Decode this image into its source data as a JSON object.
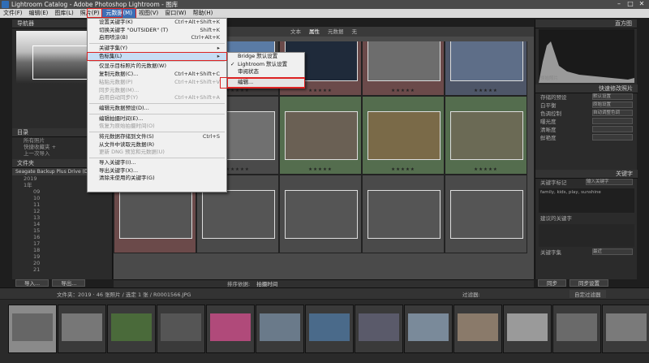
{
  "window": {
    "title": "Lightroom Catalog - Adobe Photoshop Lightroom - 图库",
    "controls": [
      "–",
      "□",
      "✕"
    ]
  },
  "menubar": {
    "items": [
      {
        "label": "文件(F)",
        "active": false
      },
      {
        "label": "编辑(E)",
        "active": false
      },
      {
        "label": "图库(L)",
        "active": false
      },
      {
        "label": "照片(P)",
        "active": false
      },
      {
        "label": "元数据(M)",
        "active": true
      },
      {
        "label": "视图(V)",
        "active": false
      },
      {
        "label": "窗口(W)",
        "active": false
      },
      {
        "label": "帮助(H)",
        "active": false
      }
    ]
  },
  "dropdown": {
    "items": [
      {
        "label": "设置关键字(K)",
        "shortcut": "Ctrl+Alt+Shift+K",
        "type": "item"
      },
      {
        "label": "切换关键字 \"OUTSIDER\" (T)",
        "shortcut": "Shift+K",
        "type": "item"
      },
      {
        "label": "启用喷涂(B)",
        "shortcut": "Ctrl+Alt+K",
        "type": "item"
      },
      {
        "type": "sep"
      },
      {
        "label": "关键字集(Y)",
        "shortcut": "▸",
        "type": "item"
      },
      {
        "label": "色标集(L)",
        "shortcut": "▸",
        "type": "highlight"
      },
      {
        "type": "sep"
      },
      {
        "label": "仅显示目标照片的元数据(W)",
        "shortcut": "",
        "type": "item"
      },
      {
        "label": "复制元数据(C)...",
        "shortcut": "Ctrl+Alt+Shift+C",
        "type": "item"
      },
      {
        "label": "粘贴元数据(P)",
        "shortcut": "Ctrl+Alt+Shift+V",
        "type": "disabled"
      },
      {
        "label": "同步元数据(M)...",
        "shortcut": "",
        "type": "disabled"
      },
      {
        "label": "启用自动同步(Y)",
        "shortcut": "Ctrl+Alt+Shift+A",
        "type": "disabled"
      },
      {
        "type": "sep"
      },
      {
        "label": "编辑元数据预设(D)...",
        "shortcut": "",
        "type": "item"
      },
      {
        "type": "sep"
      },
      {
        "label": "编辑拍摄时间(E)...",
        "shortcut": "",
        "type": "item"
      },
      {
        "label": "恢复为原始拍摄时间(O)",
        "shortcut": "",
        "type": "disabled"
      },
      {
        "type": "sep"
      },
      {
        "label": "将元数据存储到文件(S)",
        "shortcut": "Ctrl+S",
        "type": "item"
      },
      {
        "label": "从文件中读取元数据(R)",
        "shortcut": "",
        "type": "item"
      },
      {
        "label": "更新 DNG 预览和元数据(U)",
        "shortcut": "",
        "type": "disabled"
      },
      {
        "type": "sep"
      },
      {
        "label": "导入关键字(I)...",
        "shortcut": "",
        "type": "item"
      },
      {
        "label": "导出关键字(X)...",
        "shortcut": "",
        "type": "item"
      },
      {
        "label": "清除未使用的关键字(G)",
        "shortcut": "",
        "type": "item"
      }
    ]
  },
  "submenu": {
    "items": [
      {
        "label": "Bridge 默认设置",
        "checked": false
      },
      {
        "label": "Lightroom 默认设置",
        "checked": true
      },
      {
        "label": "审阅状态",
        "checked": false
      },
      {
        "label": "编辑...",
        "checked": false,
        "highlight": true
      }
    ]
  },
  "left_panel": {
    "navigator": "导航器",
    "catalog": "目录",
    "catalog_items": [
      "所有照片",
      "快捷收藏夹 +",
      "上一次导入"
    ],
    "folders": "文件夹",
    "volume": "Seagate Backup Plus Drive (D:)",
    "folder_items": [
      "2019",
      "1年",
      "09",
      "10",
      "11",
      "12",
      "13",
      "14",
      "15",
      "16",
      "17",
      "18",
      "19",
      "20",
      "21"
    ]
  },
  "left_buttons": {
    "import": "导入...",
    "export": "导出..."
  },
  "filter_bar": {
    "tabs": [
      "文本",
      "属性",
      "元数据",
      "无"
    ],
    "active": "属性"
  },
  "toolbar": {
    "sort_label": "排序依据:",
    "sort_value": "拍摄时间"
  },
  "right_panel": {
    "histogram": "直方图",
    "histogram_note": "原始照片",
    "quick_develop": "快速修改照片",
    "rows": [
      {
        "label": "存储的预设",
        "value": "默认设置"
      },
      {
        "label": "白平衡",
        "value": "原始设置"
      },
      {
        "label": "色调控制",
        "value": "自动调整色调"
      },
      {
        "label": "曝光度",
        "value": ""
      },
      {
        "label": "清晰度",
        "value": ""
      },
      {
        "label": "鲜艳度",
        "value": ""
      }
    ],
    "keywording": "关键字",
    "keyword_tags_label": "关键字标记",
    "keyword_tags_value": "输入关键字",
    "keywords_text": "family, kids, play, sunshine",
    "keyword_suggest": "建议的关键字",
    "keyword_set": "关键字集",
    "keyword_set_value": "最近"
  },
  "right_buttons": {
    "sync": "同步",
    "sync_settings": "同步设置"
  },
  "filmstrip_bar": {
    "text": "文件夹：2019 · 46 张照片 / 选定 1 张 / R0001566.JPG",
    "filter_label": "过滤器:",
    "filter_value": "自定过滤器"
  },
  "grid_cells": [
    {
      "row": 0,
      "col": 0,
      "tone": "#3d3a3a",
      "photo": "#777",
      "stars": "★★★★★"
    },
    {
      "row": 0,
      "col": 1,
      "tone": "#3d3a3a",
      "photo": "#5a7ba5",
      "stars": "★★★★★"
    },
    {
      "row": 0,
      "col": 2,
      "tone": "#6b4a4a",
      "photo": "#1f2a3a",
      "stars": "★★★★★"
    },
    {
      "row": 0,
      "col": 3,
      "tone": "#6b4a4a",
      "photo": "#6d6d6d",
      "stars": "★★★★★"
    },
    {
      "row": 0,
      "col": 4,
      "tone": "#4e5668",
      "photo": "#5e6e88",
      "stars": "★★★★★"
    },
    {
      "row": 1,
      "col": 0,
      "tone": "#6b4a4a",
      "photo": "#8a8a8a",
      "stars": "★★★★★"
    },
    {
      "row": 1,
      "col": 1,
      "tone": "#4a4a4a",
      "photo": "#707070",
      "stars": "★★★★★"
    },
    {
      "row": 1,
      "col": 2,
      "tone": "#546d4e",
      "photo": "#6a6054",
      "stars": "★★★★★"
    },
    {
      "row": 1,
      "col": 3,
      "tone": "#546d4e",
      "photo": "#7a6a48",
      "stars": "★★★★★"
    },
    {
      "row": 1,
      "col": 4,
      "tone": "#546d4e",
      "photo": "#6b6a55",
      "stars": "★★★★★"
    },
    {
      "row": 2,
      "col": 0,
      "tone": "#6b4a4a",
      "photo": "#555",
      "stars": ""
    },
    {
      "row": 2,
      "col": 1,
      "tone": "#4a4a4a",
      "photo": "#555",
      "stars": ""
    },
    {
      "row": 2,
      "col": 2,
      "tone": "#4a4a4a",
      "photo": "#555",
      "stars": ""
    },
    {
      "row": 2,
      "col": 3,
      "tone": "#4a4a4a",
      "photo": "#555",
      "stars": ""
    },
    {
      "row": 2,
      "col": 4,
      "tone": "#4a4a4a",
      "photo": "#555",
      "stars": ""
    }
  ],
  "filmstrip_thumbs": [
    "#666",
    "#777",
    "#4a6a3a",
    "#555",
    "#b04a7a",
    "#6a7a8a",
    "#4a6a8a",
    "#5a5a6a",
    "#7a8a9a",
    "#8a7a6a",
    "#9a9a9a",
    "#6a6a6a",
    "#7a7a7a"
  ]
}
